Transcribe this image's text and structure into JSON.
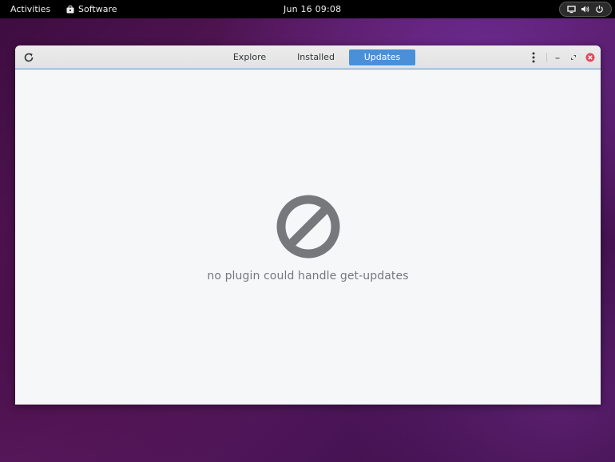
{
  "topbar": {
    "activities_label": "Activities",
    "app_menu_label": "Software",
    "clock": "Jun 16  09:08"
  },
  "header": {
    "tabs": [
      {
        "label": "Explore",
        "active": false
      },
      {
        "label": "Installed",
        "active": false
      },
      {
        "label": "Updates",
        "active": true
      }
    ]
  },
  "content": {
    "icon": "blocked-icon",
    "message": "no plugin could handle get-updates"
  },
  "colors": {
    "accent": "#4a90d9",
    "close_button": "#e0485b",
    "icon_gray": "#77787b"
  }
}
